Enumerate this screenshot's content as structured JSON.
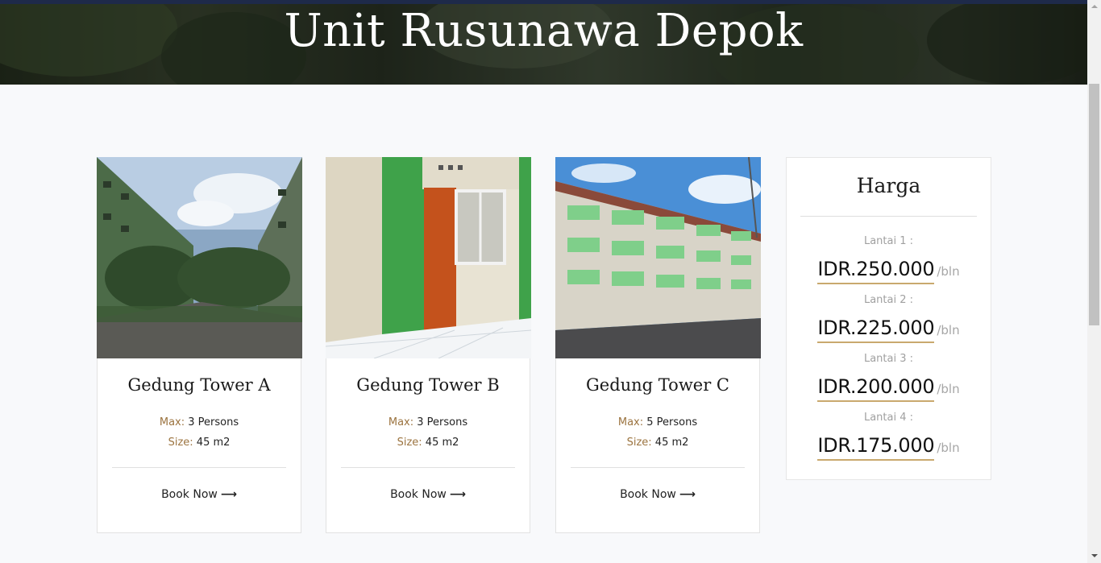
{
  "hero": {
    "title": "Unit Rusunawa Depok"
  },
  "units": [
    {
      "name": "Gedung Tower A",
      "max_label": "Max:",
      "max_value": "3 Persons",
      "size_label": "Size:",
      "size_value": "45 m2",
      "cta": "Book Now",
      "image_icon": "building-photo"
    },
    {
      "name": "Gedung Tower B",
      "max_label": "Max:",
      "max_value": "3 Persons",
      "size_label": "Size:",
      "size_value": "45 m2",
      "cta": "Book Now",
      "image_icon": "door-photo"
    },
    {
      "name": "Gedung Tower C",
      "max_label": "Max:",
      "max_value": "5 Persons",
      "size_label": "Size:",
      "size_value": "45 m2",
      "cta": "Book Now",
      "image_icon": "building-photo"
    }
  ],
  "pricing": {
    "title": "Harga",
    "unit": "/bln",
    "floors": [
      {
        "label": "Lantai 1 :",
        "price": "IDR.250.000"
      },
      {
        "label": "Lantai 2 :",
        "price": "IDR.225.000"
      },
      {
        "label": "Lantai 3 :",
        "price": "IDR.200.000"
      },
      {
        "label": "Lantai 4 :",
        "price": "IDR.175.000"
      }
    ]
  },
  "colors": {
    "accent": "#9c7440",
    "underline": "#c9a96e",
    "topbar": "#1e2a4a"
  }
}
